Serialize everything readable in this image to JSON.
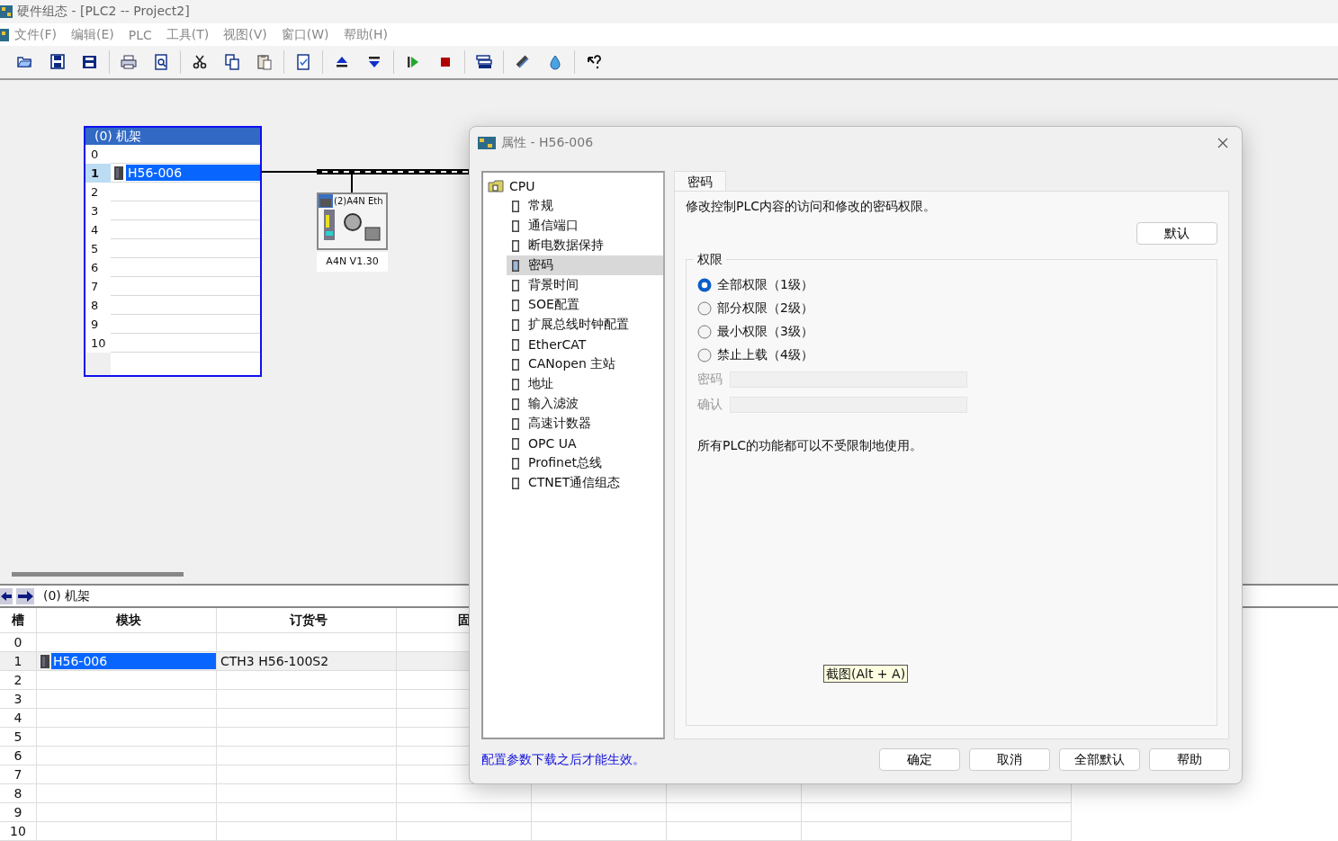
{
  "window": {
    "title": "硬件组态 - [PLC2 -- Project2]"
  },
  "menu": [
    "文件(F)",
    "编辑(E)",
    "PLC",
    "工具(T)",
    "视图(V)",
    "窗口(W)",
    "帮助(H)"
  ],
  "rack": {
    "title": "(0)  机架",
    "slots": [
      {
        "slot": "0",
        "selected": false
      },
      {
        "slot": "1",
        "module": "H56-006",
        "selected": true
      },
      {
        "slot": "2",
        "selected": false
      },
      {
        "slot": "3",
        "selected": false
      },
      {
        "slot": "4",
        "selected": false
      },
      {
        "slot": "5",
        "selected": false
      },
      {
        "slot": "6",
        "selected": false
      },
      {
        "slot": "7",
        "selected": false
      },
      {
        "slot": "8",
        "selected": false
      },
      {
        "slot": "9",
        "selected": false
      },
      {
        "slot": "10",
        "selected": false
      }
    ]
  },
  "network_device": {
    "name": "(2)A4N Eth",
    "label": "A4N V1.30"
  },
  "station_table": {
    "nav_title": "(0)  机架",
    "columns": [
      "槽",
      "模块",
      "订货号",
      "固"
    ],
    "rows": [
      {
        "slot": "0",
        "selected": false
      },
      {
        "slot": "1",
        "module": "H56-006",
        "order_number": "CTH3 H56-100S2",
        "selected": true
      },
      {
        "slot": "2",
        "selected": false
      },
      {
        "slot": "3",
        "selected": false
      },
      {
        "slot": "4",
        "selected": false
      },
      {
        "slot": "5",
        "selected": false
      },
      {
        "slot": "6",
        "selected": false
      },
      {
        "slot": "7",
        "selected": false
      },
      {
        "slot": "8",
        "selected": false
      },
      {
        "slot": "9",
        "selected": false
      },
      {
        "slot": "10",
        "selected": false
      }
    ]
  },
  "dialog": {
    "title": "属性 - H56-006",
    "tree": {
      "root": "CPU",
      "children": [
        {
          "label": "常规",
          "selected": false
        },
        {
          "label": "通信端口",
          "selected": false
        },
        {
          "label": "断电数据保持",
          "selected": false
        },
        {
          "label": "密码",
          "selected": true
        },
        {
          "label": "背景时间",
          "selected": false
        },
        {
          "label": "SOE配置",
          "selected": false
        },
        {
          "label": "扩展总线时钟配置",
          "selected": false
        },
        {
          "label": "EtherCAT",
          "selected": false
        },
        {
          "label": "CANopen 主站",
          "selected": false
        },
        {
          "label": "地址",
          "selected": false
        },
        {
          "label": "输入滤波",
          "selected": false
        },
        {
          "label": "高速计数器",
          "selected": false
        },
        {
          "label": "OPC UA",
          "selected": false
        },
        {
          "label": "Profinet总线",
          "selected": false
        },
        {
          "label": "CTNET通信组态",
          "selected": false
        }
      ]
    },
    "tabs": [
      {
        "label": "密码",
        "selected": true
      }
    ],
    "description": "修改控制PLC内容的访问和修改的密码权限。",
    "default_button": "默认",
    "permissions": {
      "title": "权限",
      "options": [
        {
          "label": "全部权限（1级）",
          "selected": true
        },
        {
          "label": "部分权限（2级）",
          "selected": false
        },
        {
          "label": "最小权限（3级）",
          "selected": false
        },
        {
          "label": "禁止上载（4级）",
          "selected": false
        }
      ]
    },
    "fields": [
      {
        "label": "密码",
        "disabled": true
      },
      {
        "label": "确认",
        "disabled": true
      }
    ],
    "note": "所有PLC的功能都可以不受限制地使用。",
    "tooltip": "截图(Alt + A)",
    "footer_note": "配置参数下载之后才能生效。",
    "buttons": [
      "确定",
      "取消",
      "全部默认",
      "帮助"
    ]
  }
}
